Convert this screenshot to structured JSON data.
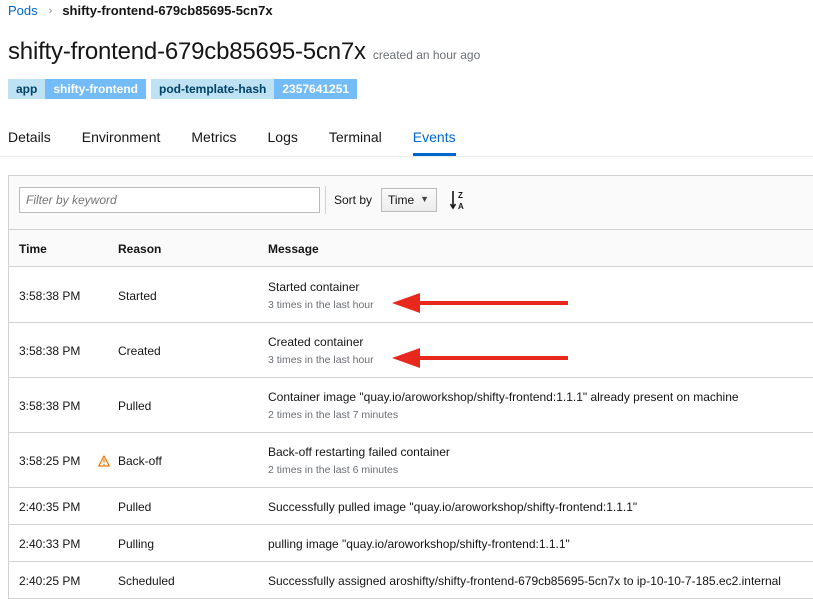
{
  "breadcrumb": {
    "parent": "Pods",
    "current": "shifty-frontend-679cb85695-5cn7x"
  },
  "header": {
    "title": "shifty-frontend-679cb85695-5cn7x",
    "created": "created an hour ago"
  },
  "labels": [
    {
      "key": "app",
      "value": "shifty-frontend"
    },
    {
      "key": "pod-template-hash",
      "value": "2357641251"
    }
  ],
  "tabs": [
    {
      "label": "Details",
      "active": false
    },
    {
      "label": "Environment",
      "active": false
    },
    {
      "label": "Metrics",
      "active": false
    },
    {
      "label": "Logs",
      "active": false
    },
    {
      "label": "Terminal",
      "active": false
    },
    {
      "label": "Events",
      "active": true
    }
  ],
  "toolbar": {
    "filter_placeholder": "Filter by keyword",
    "sort_label": "Sort by",
    "sort_value": "Time",
    "sort_icon": "sort-alpha-desc-icon"
  },
  "table": {
    "headers": {
      "time": "Time",
      "reason": "Reason",
      "message": "Message"
    },
    "rows": [
      {
        "time": "3:58:38 PM",
        "reason": "Started",
        "message": "Started container",
        "count": "3 times in the last hour",
        "warning": false,
        "annotated": true
      },
      {
        "time": "3:58:38 PM",
        "reason": "Created",
        "message": "Created container",
        "count": "3 times in the last hour",
        "warning": false,
        "annotated": true
      },
      {
        "time": "3:58:38 PM",
        "reason": "Pulled",
        "message": "Container image \"quay.io/aroworkshop/shifty-frontend:1.1.1\" already present on machine",
        "count": "2 times in the last 7 minutes",
        "warning": false,
        "annotated": false
      },
      {
        "time": "3:58:25 PM",
        "reason": "Back-off",
        "message": "Back-off restarting failed container",
        "count": "2 times in the last 6 minutes",
        "warning": true,
        "annotated": false
      },
      {
        "time": "2:40:35 PM",
        "reason": "Pulled",
        "message": "Successfully pulled image \"quay.io/aroworkshop/shifty-frontend:1.1.1\"",
        "count": "",
        "warning": false,
        "annotated": false
      },
      {
        "time": "2:40:33 PM",
        "reason": "Pulling",
        "message": "pulling image \"quay.io/aroworkshop/shifty-frontend:1.1.1\"",
        "count": "",
        "warning": false,
        "annotated": false
      },
      {
        "time": "2:40:25 PM",
        "reason": "Scheduled",
        "message": "Successfully assigned aroshifty/shifty-frontend-679cb85695-5cn7x to ip-10-10-7-185.ec2.internal",
        "count": "",
        "warning": false,
        "annotated": false
      }
    ]
  },
  "colors": {
    "link": "#0066cc",
    "warning": "#ec7a08",
    "annotation_arrow": "#e8281c"
  }
}
